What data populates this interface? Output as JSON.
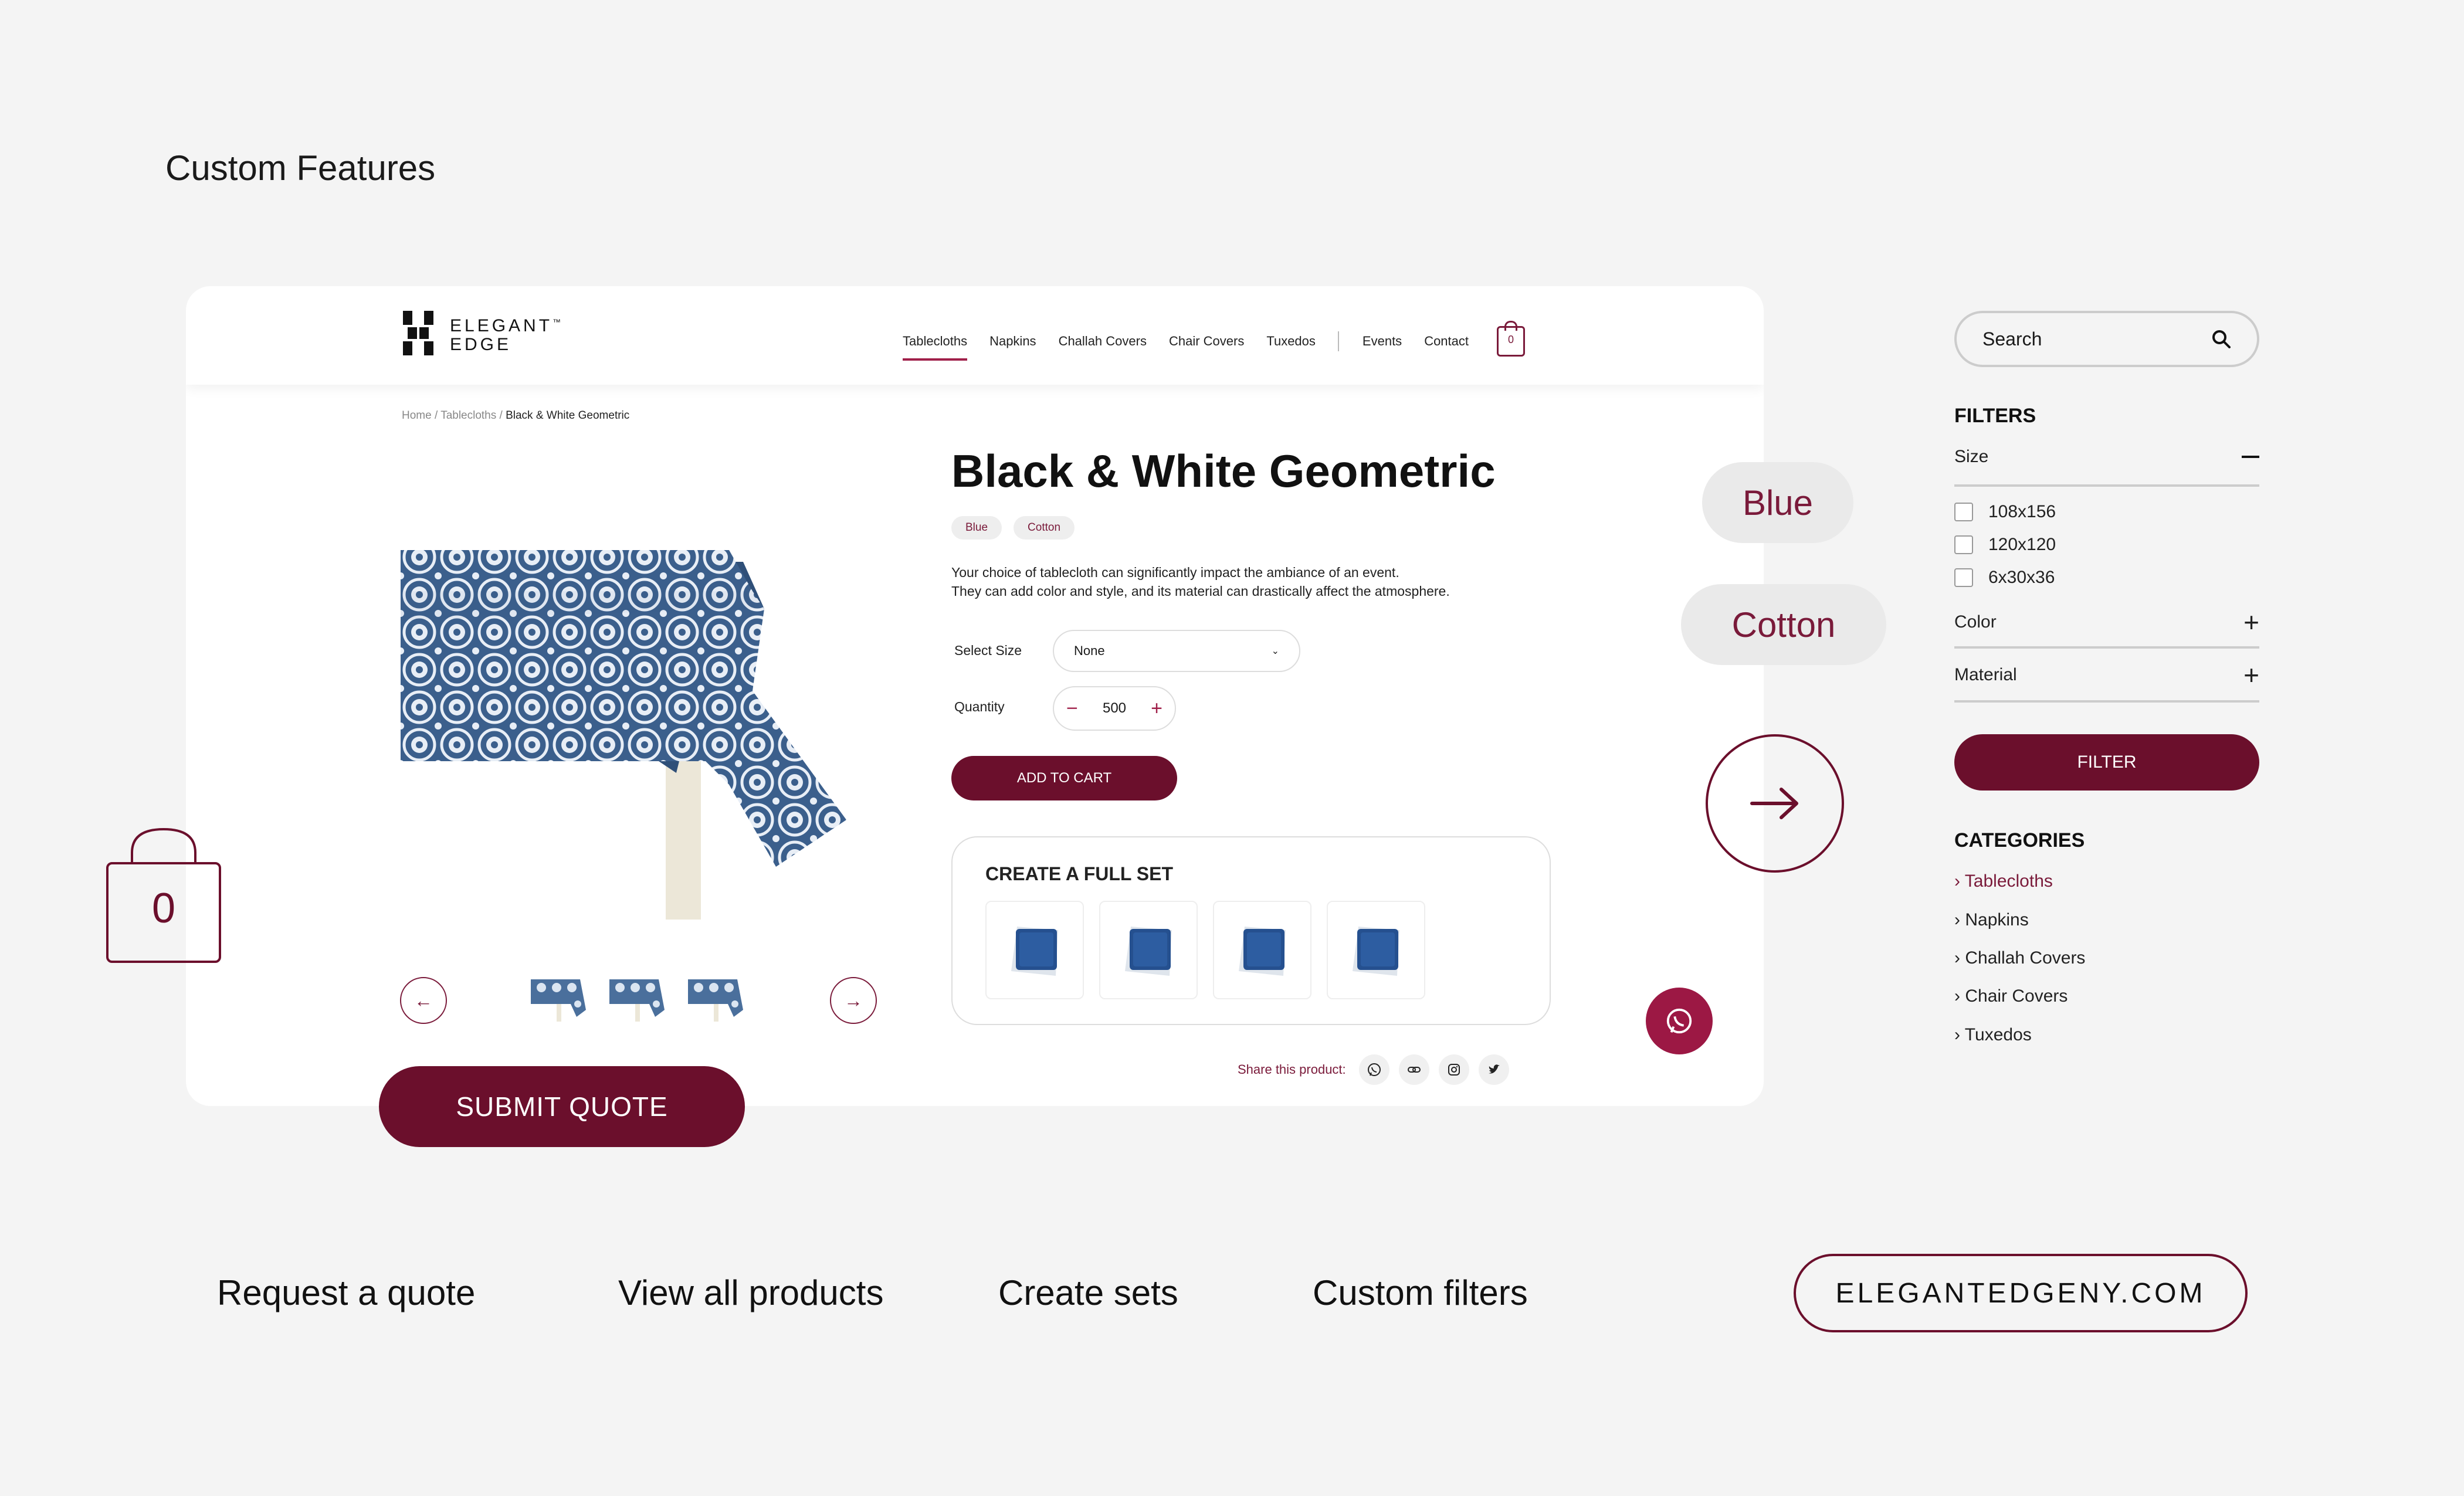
{
  "page_heading": "Custom Features",
  "nav": {
    "brand_line1": "ELEGANT",
    "brand_line2": "EDGE",
    "trademark": "™",
    "items": [
      "Tablecloths",
      "Napkins",
      "Challah Covers",
      "Chair Covers",
      "Tuxedos"
    ],
    "secondary_items": [
      "Events",
      "Contact"
    ],
    "cart_count": "0"
  },
  "breadcrumb": {
    "home": "Home",
    "sep": " / ",
    "category": "Tablecloths",
    "current": "Black & White Geometric"
  },
  "product": {
    "title": "Black & White Geometric",
    "chips": [
      "Blue",
      "Cotton"
    ],
    "desc_line1": "Your choice of tablecloth can significantly impact the ambiance of an event.",
    "desc_line2": "They can add color and style, and its material can drastically affect the atmosphere.",
    "size_label": "Select Size",
    "size_value": "None",
    "qty_label": "Quantity",
    "qty_value": "500",
    "qty_minus": "−",
    "qty_plus": "+",
    "add_to_cart": "ADD TO CART",
    "full_set_title": "CREATE A FULL SET",
    "share_label": "Share this product:"
  },
  "overlays": {
    "submit_quote": "SUBMIT QUOTE",
    "chip_blue": "Blue",
    "chip_cotton": "Cotton",
    "bag_count": "0"
  },
  "sidebar": {
    "search_placeholder": "Search",
    "filters_title": "FILTERS",
    "size_label": "Size",
    "size_options": [
      "108x156",
      "120x120",
      "6x30x36"
    ],
    "color_label": "Color",
    "material_label": "Material",
    "filter_button": "FILTER",
    "categories_title": "CATEGORIES",
    "categories": [
      "Tablecloths",
      "Napkins",
      "Challah Covers",
      "Chair Covers",
      "Tuxedos"
    ],
    "category_marker": "›"
  },
  "features": [
    "Request a quote",
    "View all products",
    "Create sets",
    "Custom filters"
  ],
  "site_link": "ELEGANTEDGENY.COM",
  "colors": {
    "accent": "#6b0f2c",
    "accent_bright": "#9c1844",
    "background": "#f4f4f4",
    "card": "#ffffff"
  }
}
